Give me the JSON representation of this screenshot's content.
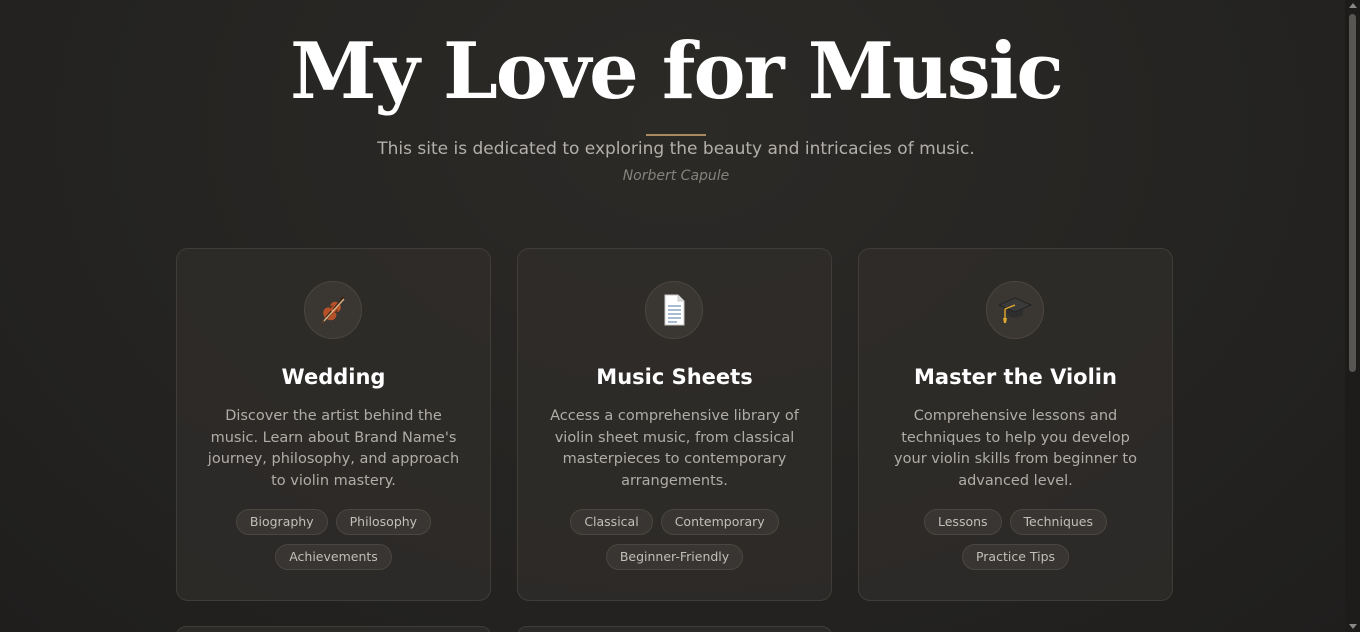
{
  "hero": {
    "title": "My Love for Music",
    "subtitle": "This site is dedicated to exploring the beauty and intricacies of music.",
    "author": "Norbert Capule"
  },
  "colors": {
    "accent": "#a88a5e",
    "background": "#262523",
    "card_border": "#403d39"
  },
  "cards": [
    {
      "icon": "violin-icon",
      "title": "Wedding",
      "description": "Discover the artist behind the music. Learn about Brand Name's journey, philosophy, and approach to violin mastery.",
      "tags": [
        "Biography",
        "Philosophy",
        "Achievements"
      ]
    },
    {
      "icon": "document-icon",
      "title": "Music Sheets",
      "description": "Access a comprehensive library of violin sheet music, from classical masterpieces to contemporary arrangements.",
      "tags": [
        "Classical",
        "Contemporary",
        "Beginner-Friendly"
      ]
    },
    {
      "icon": "graduation-cap-icon",
      "title": "Master the Violin",
      "description": "Comprehensive lessons and techniques to help you develop your violin skills from beginner to advanced level.",
      "tags": [
        "Lessons",
        "Techniques",
        "Practice Tips"
      ]
    }
  ]
}
